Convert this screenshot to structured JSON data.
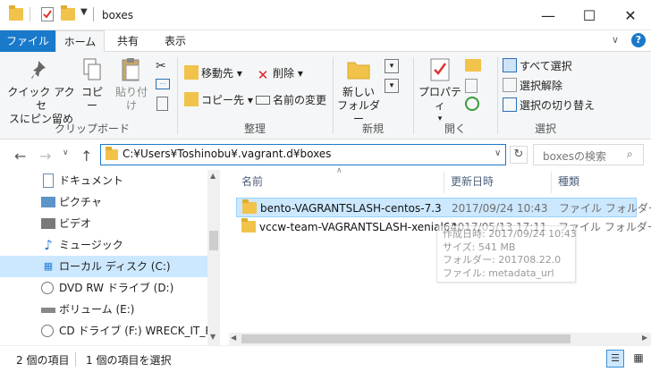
{
  "window": {
    "title": "boxes",
    "minimize": "—",
    "maximize": "☐",
    "close": "✕"
  },
  "tabs": {
    "file": "ファイル",
    "home": "ホーム",
    "share": "共有",
    "view": "表示",
    "collapse": "∨",
    "help": "?"
  },
  "ribbon": {
    "clipboard": {
      "pin_label_1": "クイック アクセ",
      "pin_label_2": "スにピン留め",
      "copy": "コピー",
      "paste": "貼り付け",
      "group": "クリップボード"
    },
    "organize": {
      "move": "移動先 ▾",
      "copy_to": "コピー先 ▾",
      "delete": "削除 ▾",
      "rename": "名前の変更",
      "group": "整理"
    },
    "new": {
      "folder_1": "新しい",
      "folder_2": "フォルダー",
      "group": "新規"
    },
    "open": {
      "properties": "プロパティ",
      "group": "開く"
    },
    "select": {
      "select_all": "すべて選択",
      "select_none": "選択解除",
      "invert": "選択の切り替え",
      "group": "選択"
    }
  },
  "address": {
    "path": "C:¥Users¥Toshinobu¥.vagrant.d¥boxes",
    "search_placeholder": "boxesの検索"
  },
  "nav_pane": {
    "items": [
      {
        "label": "ドキュメント",
        "icon": "documents-icon"
      },
      {
        "label": "ピクチャ",
        "icon": "pictures-icon"
      },
      {
        "label": "ビデオ",
        "icon": "videos-icon"
      },
      {
        "label": "ミュージック",
        "icon": "music-icon"
      },
      {
        "label": "ローカル ディスク (C:)",
        "icon": "local-disk-icon",
        "selected": true
      },
      {
        "label": "DVD RW ドライブ (D:)",
        "icon": "dvd-drive-icon"
      },
      {
        "label": "ボリューム (E:)",
        "icon": "volume-icon"
      },
      {
        "label": "CD ドライブ (F:) WRECK_IT_RALPH",
        "icon": "cd-drive-icon"
      }
    ]
  },
  "content": {
    "columns": {
      "name": "名前",
      "date": "更新日時",
      "type": "種類"
    },
    "files": [
      {
        "name": "bento-VAGRANTSLASH-centos-7.3",
        "date": "2017/09/24 10:43",
        "type": "ファイル フォルダー",
        "selected": true
      },
      {
        "name": "vccw-team-VAGRANTSLASH-xenial64",
        "date": "2017/05/13 17:11",
        "type": "ファイル フォルダー"
      }
    ]
  },
  "tooltip": {
    "created": "作成日時: 2017/09/24 10:43",
    "size": "サイズ: 541 MB",
    "folders": "フォルダー: 201708.22.0",
    "files": "ファイル: metadata_url"
  },
  "status": {
    "count": "2 個の項目",
    "selected": "1 個の項目を選択"
  },
  "colors": {
    "accent": "#1979ca",
    "selection": "#cce8ff",
    "folder": "#f1c34a"
  }
}
